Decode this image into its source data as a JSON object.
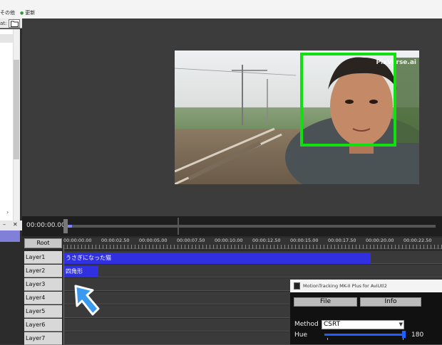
{
  "menubar": {
    "items": [
      "その他",
      "更新"
    ]
  },
  "left_panel": {
    "header_text": "at:",
    "scroll_arrow": "›",
    "bottom": {
      "minimize": "–",
      "close": "✕"
    }
  },
  "preview": {
    "watermark": "PixVerse.ai"
  },
  "seekbar": {
    "timecode": "00:00:00.00",
    "position": 0.0
  },
  "timeline": {
    "root_label": "Root",
    "ruler_ticks": [
      "00:00:00.00",
      "00:00:02.50",
      "00:00:05.00",
      "00:00:07.50",
      "00:00:10.00",
      "00:00:12.50",
      "00:00:15.00",
      "00:00:17.50",
      "00:00:20.00",
      "00:00:22.50"
    ],
    "layers": [
      "Layer1",
      "Layer2",
      "Layer3",
      "Layer4",
      "Layer5",
      "Layer6",
      "Layer7"
    ],
    "clips": [
      {
        "layer": "Layer1",
        "label": "うさぎになった猫"
      },
      {
        "layer": "Layer2",
        "label": "四角形"
      }
    ]
  },
  "plugin": {
    "title": "MotionTracking MK-II Plus for AviUtl2",
    "file_button": "File",
    "info_button": "Info",
    "method_label": "Method",
    "method_value": "CSRT",
    "hue_label": "Hue",
    "hue_value": "180",
    "hue_max": 180
  },
  "colors": {
    "accent": "#3030e0",
    "track_box": "#10e010",
    "seek_fill": "#8080ff"
  }
}
